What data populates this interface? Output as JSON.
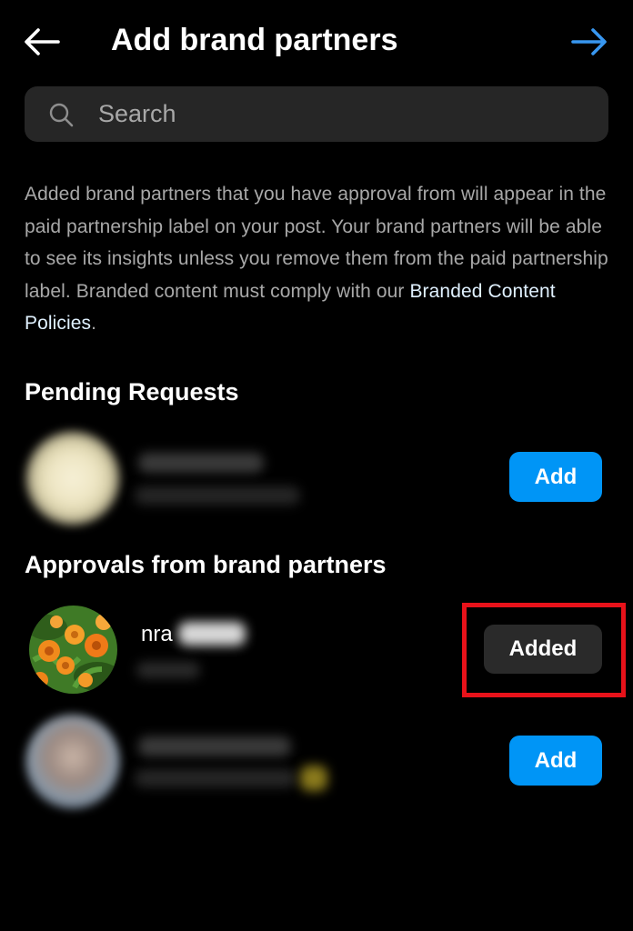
{
  "header": {
    "title": "Add brand partners",
    "back_icon": "arrow-left-icon",
    "next_icon": "arrow-right-icon",
    "next_color": "#3897f0"
  },
  "search": {
    "placeholder": "Search",
    "value": ""
  },
  "description": {
    "text": "Added brand partners that you have approval from will appear in the paid partnership label on your post. Your brand partners will be able to see its insights unless you remove them from the paid partnership label. Branded content must comply with our ",
    "link_text": "Branded Content Policies",
    "suffix": "."
  },
  "pending": {
    "heading": "Pending Requests",
    "items": [
      {
        "add_label": "Add"
      }
    ]
  },
  "approvals": {
    "heading": "Approvals from brand partners",
    "items": [
      {
        "username": "nra",
        "button_label": "Added",
        "state": "added"
      },
      {
        "button_label": "Add",
        "state": "add"
      }
    ]
  },
  "colors": {
    "background": "#000000",
    "accent_blue": "#0095f6",
    "highlight_red": "#e8121a",
    "added_button_bg": "#2a2a2a"
  }
}
